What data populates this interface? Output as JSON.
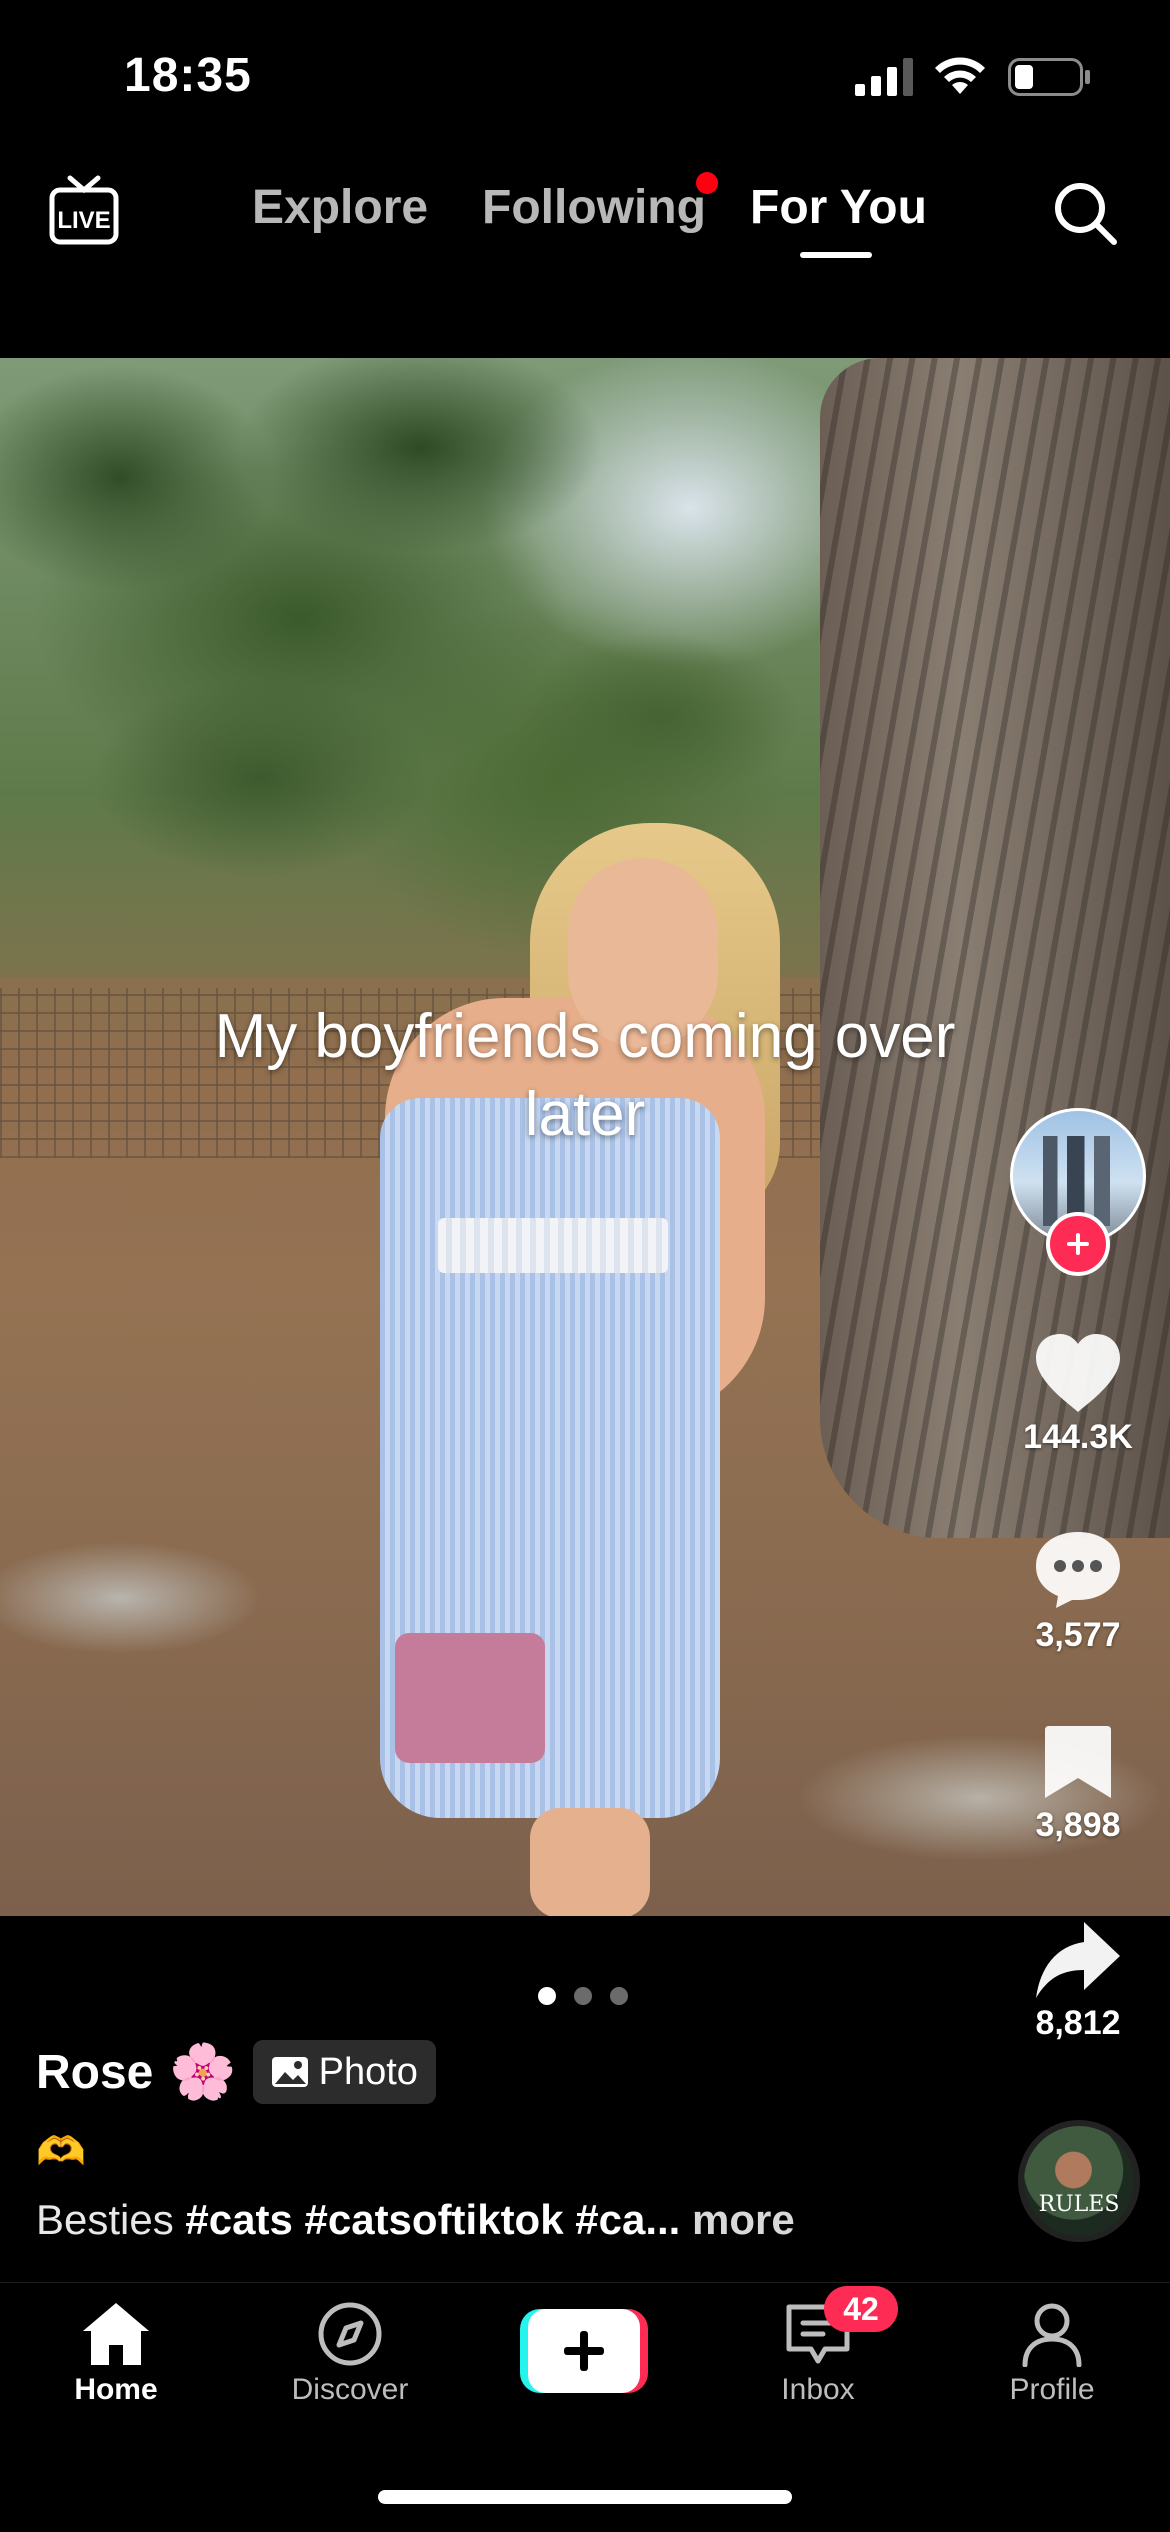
{
  "status_bar": {
    "time": "18:35",
    "icons": [
      "signal-icon",
      "wifi-icon",
      "battery-icon"
    ]
  },
  "top_nav": {
    "live_label": "LIVE",
    "tabs": [
      {
        "label": "Explore",
        "active": false
      },
      {
        "label": "Following",
        "active": false,
        "has_notification_dot": true
      },
      {
        "label": "For You",
        "active": true
      }
    ],
    "search_icon": "search-icon"
  },
  "post": {
    "overlay_text": {
      "line1": "My boyfriends coming over",
      "line2": "later"
    },
    "pagination": {
      "total": 3,
      "current": 1
    },
    "creator": {
      "name": "Rose",
      "name_emoji": "🌸",
      "post_type_label": "Photo"
    },
    "caption_emoji": "🫶",
    "description": {
      "text": "Besties ",
      "hashtags": "#cats #catsoftiktok #ca...",
      "more_label": " more"
    }
  },
  "right_rail": {
    "likes": "144.3K",
    "comments": "3,577",
    "bookmarks": "3,898",
    "shares": "8,812"
  },
  "music_disc": {
    "label": "RULES"
  },
  "tab_bar": {
    "items": [
      {
        "label": "Home",
        "icon": "home-icon",
        "active": true
      },
      {
        "label": "Discover",
        "icon": "compass-icon",
        "active": false
      },
      {
        "label": "",
        "icon": "create-plus-icon",
        "active": false
      },
      {
        "label": "Inbox",
        "icon": "inbox-icon",
        "active": false
      },
      {
        "label": "Profile",
        "icon": "profile-icon",
        "active": false
      }
    ],
    "inbox_badge": "42"
  },
  "colors": {
    "accent_red": "#fe2c55",
    "accent_cyan": "#25f4ee",
    "notification_red": "#fe0010",
    "background": "#000000"
  }
}
